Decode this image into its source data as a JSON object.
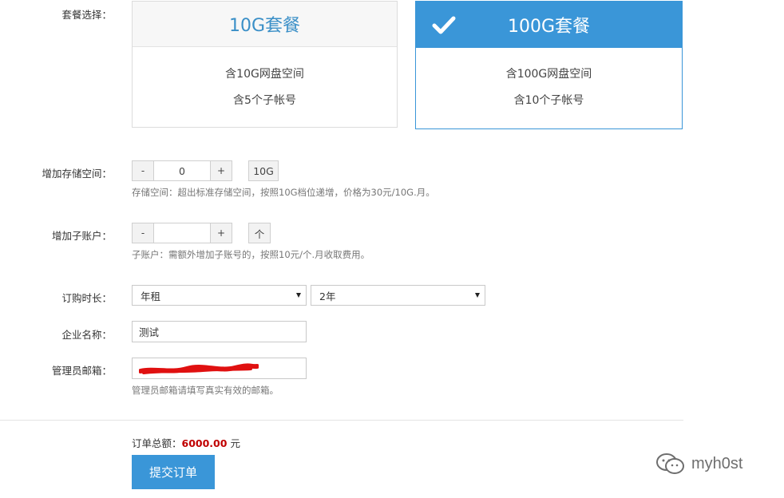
{
  "labels": {
    "package": "套餐选择：",
    "storage": "增加存储空间：",
    "subaccount": "增加子账户：",
    "duration": "订购时长：",
    "company": "企业名称：",
    "admin_email": "管理员邮箱："
  },
  "packages": [
    {
      "title": "10G套餐",
      "line1": "含10G网盘空间",
      "line2": "含5个子帐号",
      "selected": false
    },
    {
      "title": "100G套餐",
      "line1": "含100G网盘空间",
      "line2": "含10个子帐号",
      "selected": true,
      "check_icon": "checkmark-icon"
    }
  ],
  "storage": {
    "minus": "-",
    "value": "0",
    "plus": "+",
    "unit": "10G",
    "hint": "存储空间：超出标准存储空间，按照10G档位递增，价格为30元/10G.月。"
  },
  "subaccount": {
    "minus": "-",
    "value": "",
    "plus": "+",
    "unit": "个",
    "hint": "子账户：需额外增加子账号的，按照10元/个.月收取费用。"
  },
  "duration": {
    "type_value": "年租",
    "years_value": "2年"
  },
  "company": {
    "value": "测试"
  },
  "admin_email": {
    "hint": "管理员邮箱请填写真实有效的邮箱。",
    "redacted": true
  },
  "order": {
    "total_label": "订单总额：",
    "amount": "6000.00",
    "currency": "元"
  },
  "submit_label": "提交订单",
  "watermark": {
    "text": "myh0st",
    "icon": "wechat-icon"
  },
  "colors": {
    "accent": "#3a96d8",
    "amount": "#c00000",
    "redaction": "#e01010"
  }
}
